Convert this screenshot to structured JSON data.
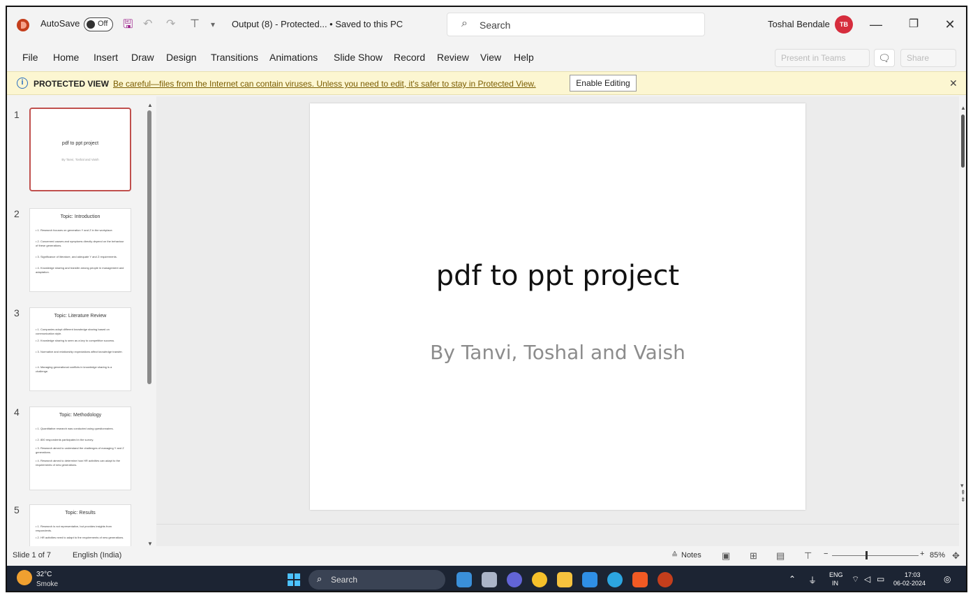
{
  "titlebar": {
    "autosave_label": "AutoSave",
    "autosave_state": "Off",
    "document_title": "Output (8)  -  Protected...  •  Saved to this PC",
    "search_placeholder": "Search",
    "user_name": "Toshal Bendale",
    "avatar_initials": "TB",
    "minimize": "—",
    "restore": "❐",
    "close": "✕"
  },
  "menu": {
    "items": [
      "File",
      "Home",
      "Insert",
      "Draw",
      "Design",
      "Transitions",
      "Animations",
      "Slide Show",
      "Record",
      "Review",
      "View",
      "Help"
    ],
    "present_in_teams": "Present in Teams",
    "comments": "🗨",
    "share": "Share"
  },
  "protected_view": {
    "label": "PROTECTED VIEW",
    "message": "Be careful—files from the Internet can contain viruses. Unless you need to edit, it's safer to stay in Protected View.",
    "enable_button": "Enable Editing",
    "close": "✕"
  },
  "thumbnails": [
    {
      "num": "1",
      "title": "pdf to ppt project",
      "subtitle": "By Tanvi, Toshal and Vaish",
      "lines": []
    },
    {
      "num": "2",
      "title": "Topic: Introduction",
      "subtitle": "",
      "lines": [
        "• 1. Research focuses on generation Y and Z in the workplace.",
        "• 2. Concerned causes and symptoms directly depend on the behaviour of these generations.",
        "• 3. Significance of literature, and adequate Y and Z requirements.",
        "• 4. Knowledge sharing and transfer among people in management and adaptation."
      ]
    },
    {
      "num": "3",
      "title": "Topic: Literature Review",
      "subtitle": "",
      "lines": [
        "• 1. Companies adopt different knowledge sharing based on communication style.",
        "• 2. Knowledge sharing is seen as a key to competitive success.",
        "• 3. Normative and relationship expectations affect knowledge transfer.",
        "• 4. Managing generational conflicts in knowledge sharing is a challenge."
      ]
    },
    {
      "num": "4",
      "title": "Topic: Methodology",
      "subtitle": "",
      "lines": [
        "• 1. Quantitative research was conducted using questionnaires.",
        "• 2. 800 respondents participated in the survey.",
        "• 3. Research aimed to understand the challenges of managing Y and Z generations.",
        "• 4. Research aimed to determine how HR activities can adapt to the requirements of new generations."
      ]
    },
    {
      "num": "5",
      "title": "Topic: Results",
      "subtitle": "",
      "lines": [
        "• 1. Research is not representative, but provides insights from respondents.",
        "• 2. HR activities need to adapt to the requirements of new generations."
      ]
    }
  ],
  "slide": {
    "title": "pdf to ppt project",
    "subtitle": "By Tanvi, Toshal and Vaish"
  },
  "status": {
    "slide_count": "Slide 1 of 7",
    "language": "English (India)",
    "notes": "Notes",
    "zoom": "85%",
    "zoom_level": 0.45
  },
  "taskbar": {
    "temperature": "32°C",
    "weather": "Smoke",
    "search": "Search",
    "lang_top": "ENG",
    "lang_bottom": "IN",
    "time": "17:03",
    "date": "06-02-2024"
  },
  "colors": {
    "accent": "#c43e1c",
    "protected_bar": "#fcf6d1",
    "taskbar": "#1c2433",
    "selected_thumb": "#c0504d"
  }
}
